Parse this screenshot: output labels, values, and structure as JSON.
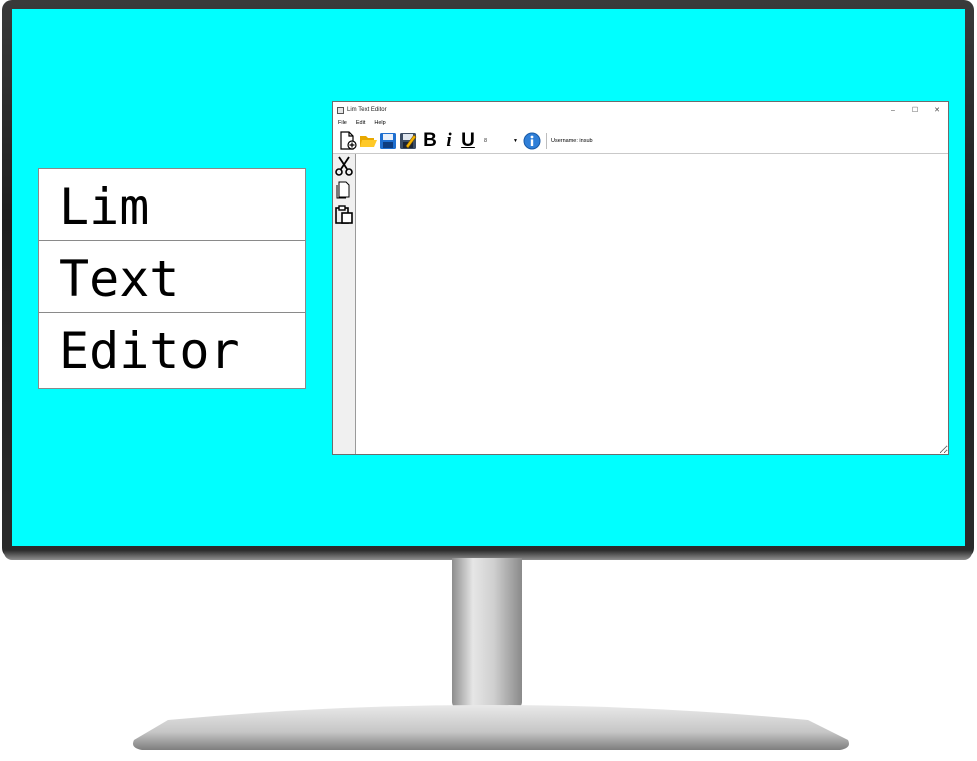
{
  "title_card": {
    "lines": [
      "Lim",
      "Text",
      "Editor"
    ]
  },
  "window": {
    "title": "Lim Text Editor",
    "controls": {
      "minimize": "–",
      "maximize": "☐",
      "close": "✕"
    }
  },
  "menu": {
    "items": [
      "File",
      "Edit",
      "Help"
    ]
  },
  "toolbar": {
    "buttons": [
      "new-document-icon",
      "open-folder-icon",
      "save-icon",
      "save-as-icon"
    ],
    "bold_label": "B",
    "italic_label": "i",
    "underline_label": "U",
    "font_size": "8",
    "username_text": "Username: insub"
  },
  "side_tools": [
    "cut-icon",
    "copy-icon",
    "paste-icon"
  ],
  "editor": {
    "content": ""
  },
  "colors": {
    "screen_bg": "#00ffff",
    "accent": "#1e88e5"
  }
}
